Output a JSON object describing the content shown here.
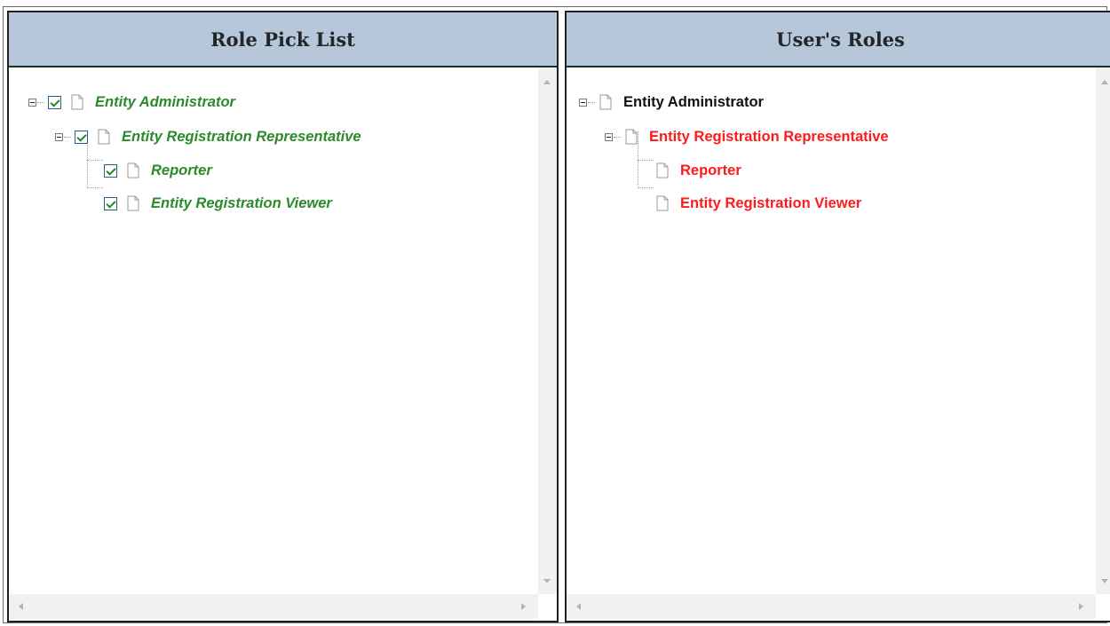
{
  "left_panel": {
    "title": "Role Pick List",
    "items": [
      {
        "label": "Entity Administrator",
        "checked": true,
        "expanded": true
      },
      {
        "label": "Entity Registration Representative",
        "checked": true,
        "expanded": true
      },
      {
        "label": "Reporter",
        "checked": true
      },
      {
        "label": "Entity Registration Viewer",
        "checked": true
      }
    ]
  },
  "right_panel": {
    "title": "User's Roles",
    "items": [
      {
        "label": "Entity Administrator",
        "color": "#111111",
        "expanded": true
      },
      {
        "label": "Entity Registration Representative",
        "color": "#ff1a1a",
        "expanded": true
      },
      {
        "label": "Reporter",
        "color": "#ff1a1a"
      },
      {
        "label": "Entity Registration Viewer",
        "color": "#ff1a1a"
      }
    ]
  },
  "colors": {
    "header_bg": "#b6c7d9",
    "pick_label": "#2b8a2b",
    "assigned_label": "#111111",
    "inherited_label": "#ff1a1a",
    "checkbox_check": "#1e8b2d"
  },
  "icons": {
    "node": "document-icon",
    "expand": "collapse-minus-icon"
  }
}
